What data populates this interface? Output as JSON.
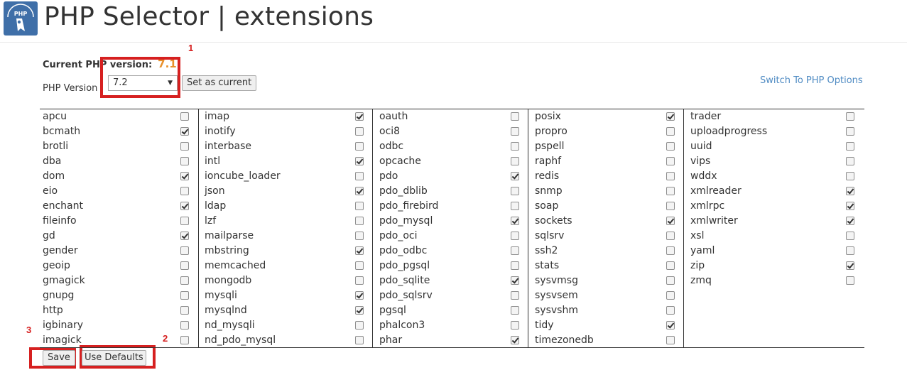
{
  "header": {
    "title": "PHP Selector | extensions",
    "logo_text": "PHP"
  },
  "version": {
    "current_label": "Current PHP version:",
    "current_value": "7.1",
    "select_label": "PHP Version",
    "selected": "7.2",
    "set_current_label": "Set as current",
    "switch_link": "Switch To PHP Options"
  },
  "annotations": [
    "1",
    "2",
    "3"
  ],
  "colors": {
    "annotation": "#d62020",
    "link": "#4f8bc3",
    "version_accent": "#e8902b"
  },
  "extensions": [
    [
      {
        "name": "apcu",
        "checked": false
      },
      {
        "name": "bcmath",
        "checked": true
      },
      {
        "name": "brotli",
        "checked": false
      },
      {
        "name": "dba",
        "checked": false
      },
      {
        "name": "dom",
        "checked": true
      },
      {
        "name": "eio",
        "checked": false
      },
      {
        "name": "enchant",
        "checked": true
      },
      {
        "name": "fileinfo",
        "checked": false
      },
      {
        "name": "gd",
        "checked": true
      },
      {
        "name": "gender",
        "checked": false
      },
      {
        "name": "geoip",
        "checked": false
      },
      {
        "name": "gmagick",
        "checked": false
      },
      {
        "name": "gnupg",
        "checked": false
      },
      {
        "name": "http",
        "checked": false
      },
      {
        "name": "igbinary",
        "checked": false
      },
      {
        "name": "imagick",
        "checked": false
      }
    ],
    [
      {
        "name": "imap",
        "checked": true
      },
      {
        "name": "inotify",
        "checked": false
      },
      {
        "name": "interbase",
        "checked": false
      },
      {
        "name": "intl",
        "checked": true
      },
      {
        "name": "ioncube_loader",
        "checked": false
      },
      {
        "name": "json",
        "checked": true
      },
      {
        "name": "ldap",
        "checked": false
      },
      {
        "name": "lzf",
        "checked": false
      },
      {
        "name": "mailparse",
        "checked": false
      },
      {
        "name": "mbstring",
        "checked": true
      },
      {
        "name": "memcached",
        "checked": false
      },
      {
        "name": "mongodb",
        "checked": false
      },
      {
        "name": "mysqli",
        "checked": true
      },
      {
        "name": "mysqlnd",
        "checked": true
      },
      {
        "name": "nd_mysqli",
        "checked": false
      },
      {
        "name": "nd_pdo_mysql",
        "checked": false
      }
    ],
    [
      {
        "name": "oauth",
        "checked": false
      },
      {
        "name": "oci8",
        "checked": false
      },
      {
        "name": "odbc",
        "checked": false
      },
      {
        "name": "opcache",
        "checked": false
      },
      {
        "name": "pdo",
        "checked": true
      },
      {
        "name": "pdo_dblib",
        "checked": false
      },
      {
        "name": "pdo_firebird",
        "checked": false
      },
      {
        "name": "pdo_mysql",
        "checked": true
      },
      {
        "name": "pdo_oci",
        "checked": false
      },
      {
        "name": "pdo_odbc",
        "checked": false
      },
      {
        "name": "pdo_pgsql",
        "checked": false
      },
      {
        "name": "pdo_sqlite",
        "checked": true
      },
      {
        "name": "pdo_sqlsrv",
        "checked": false
      },
      {
        "name": "pgsql",
        "checked": false
      },
      {
        "name": "phalcon3",
        "checked": false
      },
      {
        "name": "phar",
        "checked": true
      }
    ],
    [
      {
        "name": "posix",
        "checked": true
      },
      {
        "name": "propro",
        "checked": false
      },
      {
        "name": "pspell",
        "checked": false
      },
      {
        "name": "raphf",
        "checked": false
      },
      {
        "name": "redis",
        "checked": false
      },
      {
        "name": "snmp",
        "checked": false
      },
      {
        "name": "soap",
        "checked": false
      },
      {
        "name": "sockets",
        "checked": true
      },
      {
        "name": "sqlsrv",
        "checked": false
      },
      {
        "name": "ssh2",
        "checked": false
      },
      {
        "name": "stats",
        "checked": false
      },
      {
        "name": "sysvmsg",
        "checked": false
      },
      {
        "name": "sysvsem",
        "checked": false
      },
      {
        "name": "sysvshm",
        "checked": false
      },
      {
        "name": "tidy",
        "checked": true
      },
      {
        "name": "timezonedb",
        "checked": false
      }
    ],
    [
      {
        "name": "trader",
        "checked": false
      },
      {
        "name": "uploadprogress",
        "checked": false
      },
      {
        "name": "uuid",
        "checked": false
      },
      {
        "name": "vips",
        "checked": false
      },
      {
        "name": "wddx",
        "checked": false
      },
      {
        "name": "xmlreader",
        "checked": true
      },
      {
        "name": "xmlrpc",
        "checked": true
      },
      {
        "name": "xmlwriter",
        "checked": true
      },
      {
        "name": "xsl",
        "checked": false
      },
      {
        "name": "yaml",
        "checked": false
      },
      {
        "name": "zip",
        "checked": true
      },
      {
        "name": "zmq",
        "checked": false
      }
    ]
  ],
  "footer": {
    "save_label": "Save",
    "defaults_label": "Use Defaults"
  }
}
